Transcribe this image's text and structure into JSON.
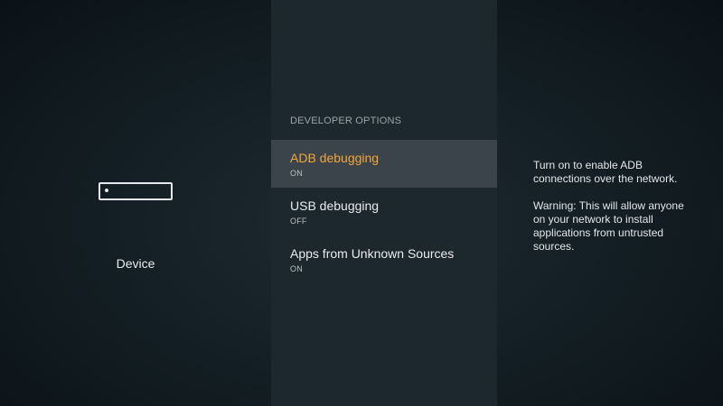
{
  "left": {
    "icon": "fire-tv-stick-icon",
    "label": "Device"
  },
  "middle": {
    "section_title": "DEVELOPER OPTIONS",
    "items": [
      {
        "title": "ADB debugging",
        "status": "ON",
        "selected": true
      },
      {
        "title": "USB debugging",
        "status": "OFF",
        "selected": false
      },
      {
        "title": "Apps from Unknown Sources",
        "status": "ON",
        "selected": false
      }
    ]
  },
  "right": {
    "description": "Turn on to enable ADB connections over the network.",
    "warning": "Warning: This will allow anyone on your network to install applications from untrusted sources."
  },
  "colors": {
    "accent": "#f3a53a",
    "selected_bg": "#3a444a",
    "panel_bg": "#1d282e"
  }
}
